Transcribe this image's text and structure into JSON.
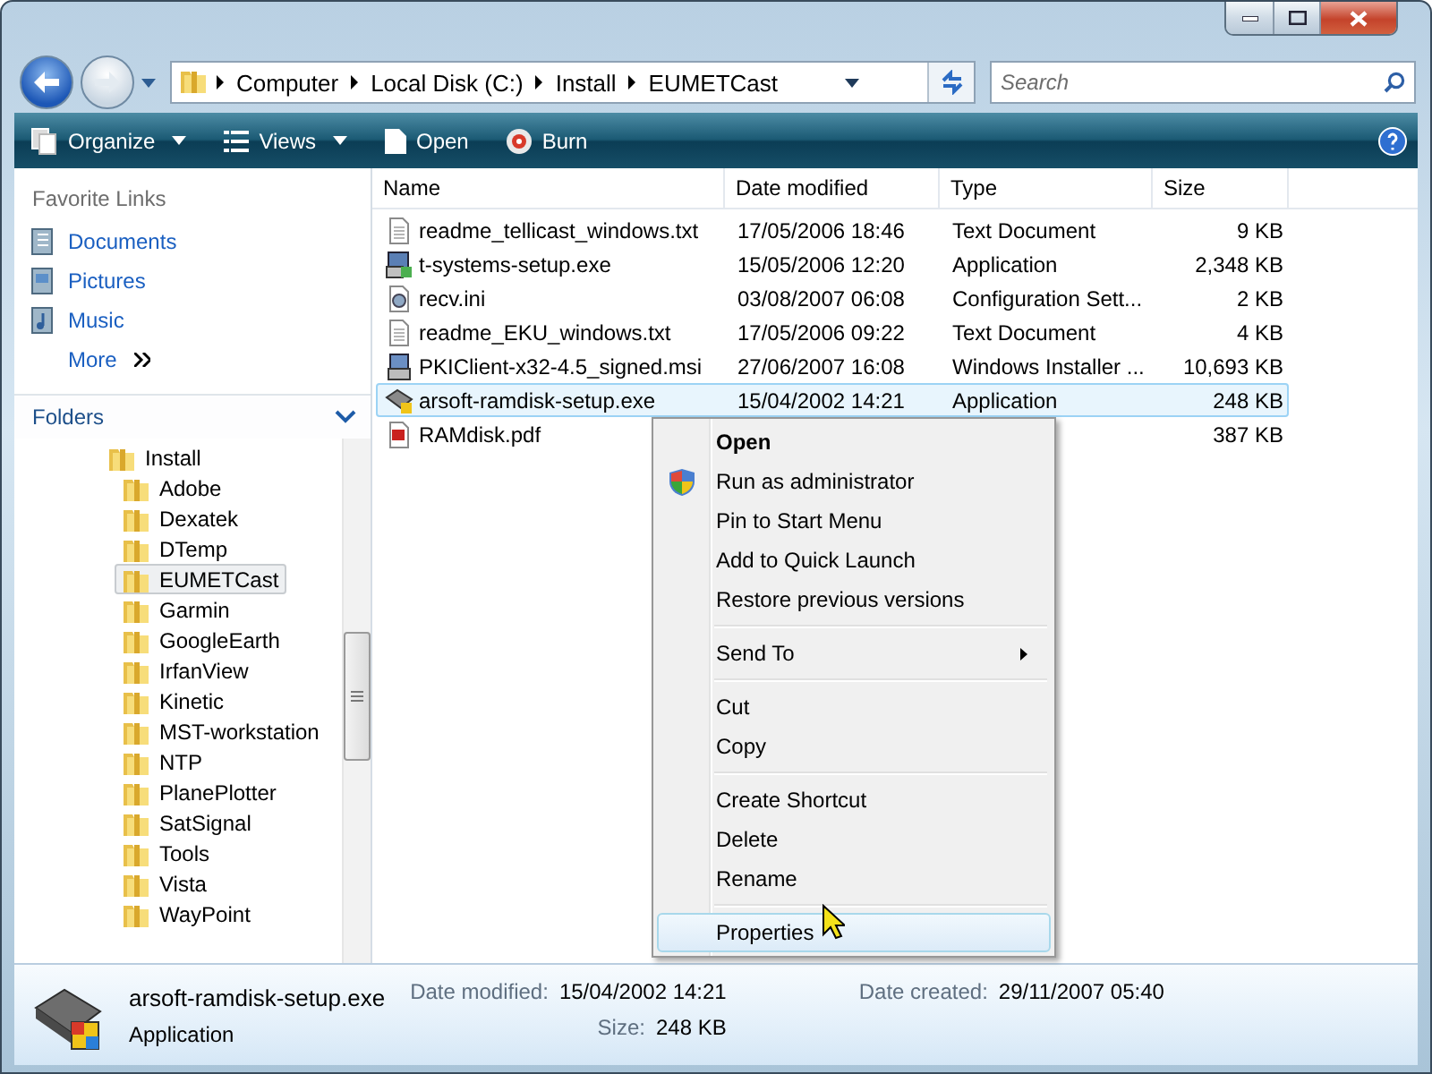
{
  "address_bar": {
    "crumbs": [
      "Computer",
      "Local Disk (C:)",
      "Install",
      "EUMETCast"
    ]
  },
  "search": {
    "placeholder": "Search"
  },
  "toolbar": [
    {
      "label": "Organize",
      "kind": "organize",
      "dropdown": true
    },
    {
      "label": "Views",
      "kind": "views",
      "dropdown": true
    },
    {
      "label": "Open",
      "kind": "open",
      "dropdown": false
    },
    {
      "label": "Burn",
      "kind": "burn",
      "dropdown": false
    }
  ],
  "favorite_links": {
    "title": "Favorite Links",
    "items": [
      {
        "label": "Documents",
        "kind": "documents"
      },
      {
        "label": "Pictures",
        "kind": "pictures"
      },
      {
        "label": "Music",
        "kind": "music"
      },
      {
        "label": "More",
        "kind": "more"
      }
    ]
  },
  "folders": {
    "title": "Folders",
    "tree": [
      {
        "label": "Install",
        "selected": false,
        "children": [
          {
            "label": "Adobe",
            "selected": false
          },
          {
            "label": "Dexatek",
            "selected": false
          },
          {
            "label": "DTemp",
            "selected": false
          },
          {
            "label": "EUMETCast",
            "selected": true
          },
          {
            "label": "Garmin",
            "selected": false
          },
          {
            "label": "GoogleEarth",
            "selected": false
          },
          {
            "label": "IrfanView",
            "selected": false
          },
          {
            "label": "Kinetic",
            "selected": false
          },
          {
            "label": "MST-workstation",
            "selected": false
          },
          {
            "label": "NTP",
            "selected": false
          },
          {
            "label": "PlanePlotter",
            "selected": false
          },
          {
            "label": "SatSignal",
            "selected": false
          },
          {
            "label": "Tools",
            "selected": false
          },
          {
            "label": "Vista",
            "selected": false
          },
          {
            "label": "WayPoint",
            "selected": false
          }
        ]
      }
    ]
  },
  "file_list": {
    "columns": [
      "Name",
      "Date modified",
      "Type",
      "Size"
    ],
    "rows": [
      {
        "kind": "text",
        "name": "readme_tellicast_windows.txt",
        "date": "17/05/2006 18:46",
        "type": "Text Document",
        "size": "9 KB",
        "selected": false
      },
      {
        "kind": "setup",
        "name": "t-systems-setup.exe",
        "date": "15/05/2006 12:20",
        "type": "Application",
        "size": "2,348 KB",
        "selected": false
      },
      {
        "kind": "settings",
        "name": "recv.ini",
        "date": "03/08/2007 06:08",
        "type": "Configuration Sett...",
        "size": "2 KB",
        "selected": false
      },
      {
        "kind": "text",
        "name": "readme_EKU_windows.txt",
        "date": "17/05/2006 09:22",
        "type": "Text Document",
        "size": "4 KB",
        "selected": false
      },
      {
        "kind": "installer",
        "name": "PKIClient-x32-4.5_signed.msi",
        "date": "27/06/2007 16:08",
        "type": "Windows Installer ...",
        "size": "10,693 KB",
        "selected": false
      },
      {
        "kind": "drive",
        "name": "arsoft-ramdisk-setup.exe",
        "date": "15/04/2002 14:21",
        "type": "Application",
        "size": "248 KB",
        "selected": true
      },
      {
        "kind": "pdf",
        "name": "RAMdisk.pdf",
        "size": "387 KB",
        "selected": false
      }
    ]
  },
  "context_menu": {
    "groups": [
      [
        {
          "label": "Open",
          "default": true,
          "shield": false,
          "submenu": false,
          "selected": false
        },
        {
          "label": "Run as administrator",
          "default": false,
          "shield": true,
          "submenu": false,
          "selected": false
        },
        {
          "label": "Pin to Start Menu",
          "default": false,
          "shield": false,
          "submenu": false,
          "selected": false
        },
        {
          "label": "Add to Quick Launch",
          "default": false,
          "shield": false,
          "submenu": false,
          "selected": false
        },
        {
          "label": "Restore previous versions",
          "default": false,
          "shield": false,
          "submenu": false,
          "selected": false
        }
      ],
      [
        {
          "label": "Send To",
          "default": false,
          "shield": false,
          "submenu": true,
          "selected": false
        }
      ],
      [
        {
          "label": "Cut",
          "default": false,
          "shield": false,
          "submenu": false,
          "selected": false
        },
        {
          "label": "Copy",
          "default": false,
          "shield": false,
          "submenu": false,
          "selected": false
        }
      ],
      [
        {
          "label": "Create Shortcut",
          "default": false,
          "shield": false,
          "submenu": false,
          "selected": false
        },
        {
          "label": "Delete",
          "default": false,
          "shield": false,
          "submenu": false,
          "selected": false
        },
        {
          "label": "Rename",
          "default": false,
          "shield": false,
          "submenu": false,
          "selected": false
        }
      ],
      [
        {
          "label": "Properties",
          "default": false,
          "shield": false,
          "submenu": false,
          "selected": true
        }
      ]
    ]
  },
  "details": {
    "name": "arsoft-ramdisk-setup.exe",
    "type": "Application",
    "columns": [
      [
        {
          "label": "Date modified:",
          "value": "15/04/2002 14:21"
        },
        {
          "label": "Size:",
          "value": "248 KB"
        }
      ],
      [
        {
          "label": "Date created:",
          "value": "29/11/2007 05:40"
        }
      ]
    ]
  }
}
